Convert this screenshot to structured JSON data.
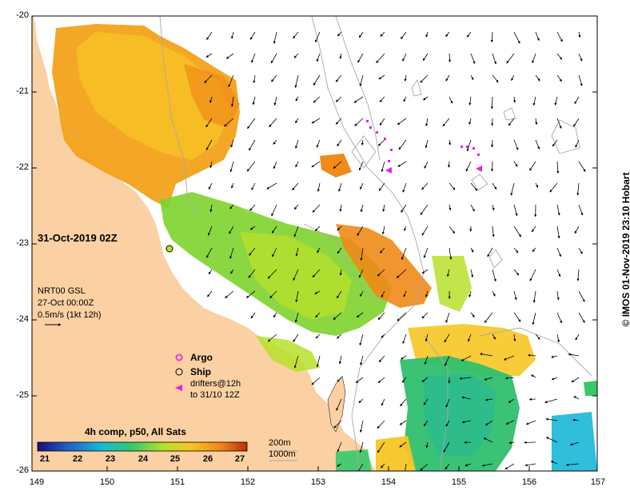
{
  "timestamp": "31-Oct-2019 02Z",
  "current_source": "NRT00 GSL",
  "current_date": "27-Oct 00:00Z",
  "scale_arrow": "0.5m/s (1kt 12h)",
  "legend": {
    "argo": "Argo",
    "ship": "Ship",
    "drifters_line1": "drifters@12h",
    "drifters_line2": "to 31/10 12Z"
  },
  "colorbar": {
    "title": "4h comp, p50, All Sats",
    "ticks": [
      "21",
      "22",
      "23",
      "24",
      "25",
      "26",
      "27"
    ],
    "colors": [
      "#1a0e7a",
      "#1f5cc8",
      "#18b7d8",
      "#36c96a",
      "#b6e02a",
      "#f7c424",
      "#f08a18",
      "#c22a0c"
    ]
  },
  "isobaths": {
    "shallow": "200m",
    "deep": "1000m"
  },
  "credit": "© IMOS 01-Nov-2019 23:10 Hobart",
  "axes": {
    "lon_ticks": [
      "149",
      "150",
      "151",
      "152",
      "153",
      "154",
      "155",
      "156",
      "157"
    ],
    "lat_ticks": [
      "-20",
      "-21",
      "-22",
      "-23",
      "-24",
      "-25",
      "-26"
    ]
  },
  "colors": {
    "land": "#fbd0a2",
    "arrow": "#000000",
    "argo": "#e23ad8",
    "drifter": "#e81ee8",
    "isobath": "#a8a8a8"
  }
}
